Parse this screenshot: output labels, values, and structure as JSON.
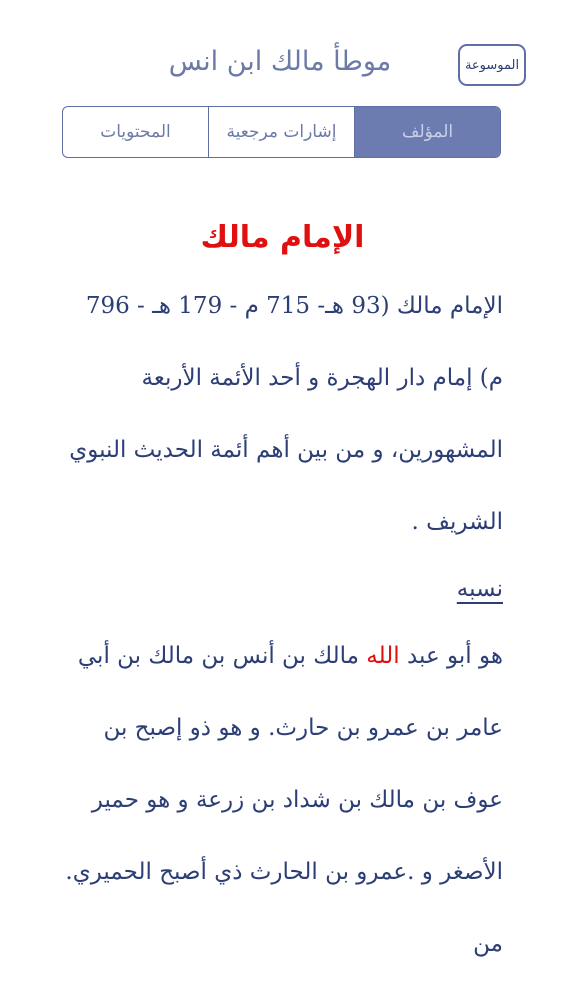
{
  "header": {
    "title": "موطأ مالك ابن انس",
    "encyclopedia_button": "الموسوعة"
  },
  "tabs": [
    {
      "label": "المؤلف",
      "active": true
    },
    {
      "label": "إشارات مرجعية",
      "active": false
    },
    {
      "label": "المحتويات",
      "active": false
    }
  ],
  "article": {
    "title": "الإمام مالك",
    "intro": "الإمام مالك (93 هـ- 715 م - 179 هـ - 796 م) إمام دار الهجرة و أحد الأئمة الأربعة المشهورين، و من بين أهم أئمة الحديث النبوي الشريف .",
    "section_heading": "نسبه",
    "lineage_before": "هو أبو عبد ",
    "lineage_highlight": "الله",
    "lineage_after": " مالك بن أنس بن مالك بن أبي عامر بن عمرو بن حارث. و هو ذو إصبح بن عوف بن مالك بن شداد بن زرعة و هو حمير الأصغر و .عمرو بن الحارث ذي أصبح الحميري. من"
  },
  "colors": {
    "accent": "#6c7bb0",
    "text": "#2c3e75",
    "highlight": "#e01010"
  }
}
